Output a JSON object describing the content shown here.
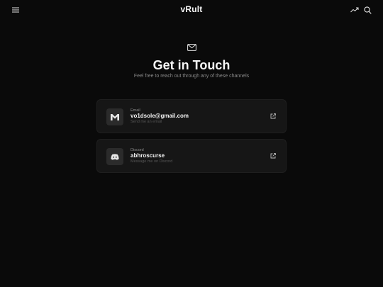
{
  "header": {
    "logo": "vRult",
    "menu_icon": "hamburger-icon",
    "trending_icon": "trending-up-icon",
    "search_icon": "search-icon"
  },
  "hero": {
    "icon": "mail-icon",
    "title": "Get in Touch",
    "subtitle": "Feel free to reach out through any of these channels"
  },
  "contacts": [
    {
      "label": "Email",
      "value": "vo1dsole@gmail.com",
      "description": "Send me an email",
      "icon": "gmail-icon",
      "action_icon": "external-link-icon"
    },
    {
      "label": "Discord",
      "value": "abhroscurse",
      "description": "Message me on Discord",
      "icon": "discord-icon",
      "action_icon": "external-link-icon"
    }
  ],
  "colors": {
    "background": "#0a0a0a",
    "card": "#161616",
    "icon_box": "#2b2b2b",
    "text": "#f2f2f2",
    "muted": "#8a8a8a"
  }
}
